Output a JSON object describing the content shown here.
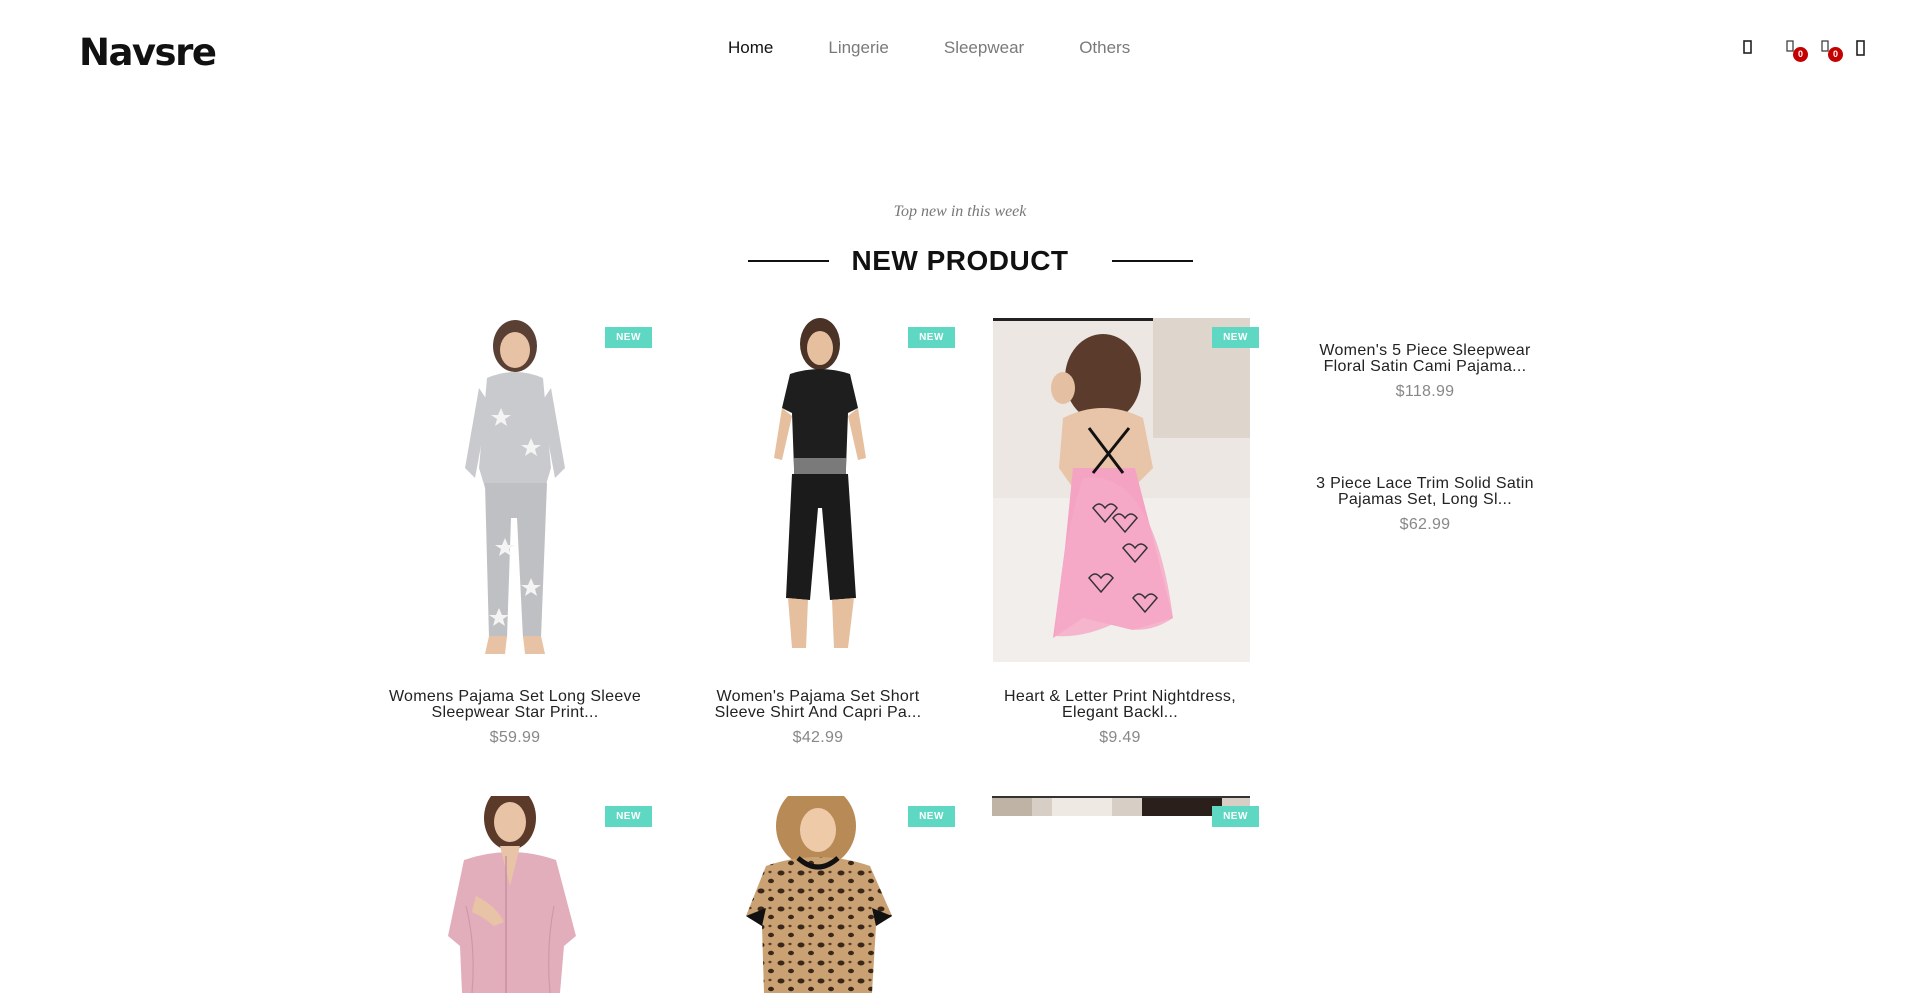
{
  "header": {
    "logo": "Navsre",
    "nav": [
      {
        "label": "Home",
        "active": true
      },
      {
        "label": "Lingerie",
        "active": false
      },
      {
        "label": "Sleepwear",
        "active": false
      },
      {
        "label": "Others",
        "active": false
      }
    ],
    "icons": {
      "search": "search-icon",
      "wishlist": "heart-icon",
      "wishlist_count": "0",
      "cart": "cart-icon",
      "cart_count": "0",
      "menu": "menu-icon"
    }
  },
  "section": {
    "subtitle": "Top new in this week",
    "title": "NEW PRODUCT"
  },
  "products": [
    {
      "name_line1": "Womens Pajama Set Long Sleeve",
      "name_line2": "Sleepwear Star Print...",
      "price": "$59.99",
      "badge": "NEW"
    },
    {
      "name_line1": "Women's Pajama Set Short",
      "name_line2": "Sleeve Shirt And Capri Pa...",
      "price": "$42.99",
      "badge": "NEW"
    },
    {
      "name_line1": "Heart & Letter Print Nightdress,",
      "name_line2": "Elegant Backl...",
      "price": "$9.49",
      "badge": "NEW"
    },
    {
      "badge": "NEW"
    },
    {
      "badge": "NEW"
    },
    {
      "badge": "NEW"
    }
  ],
  "side_products": [
    {
      "name_line1": "Women's 5 Piece Sleepwear",
      "name_line2": "Floral Satin Cami Pajama...",
      "price": "$118.99"
    },
    {
      "name_line1": "3 Piece Lace Trim Solid Satin",
      "name_line2": "Pajamas Set, Long Sl...",
      "price": "$62.99"
    }
  ],
  "colors": {
    "badge_new": "#5ed8c3",
    "count_badge": "#c40000",
    "nav_active": "#111111",
    "nav_inactive": "#7a7a7a"
  }
}
